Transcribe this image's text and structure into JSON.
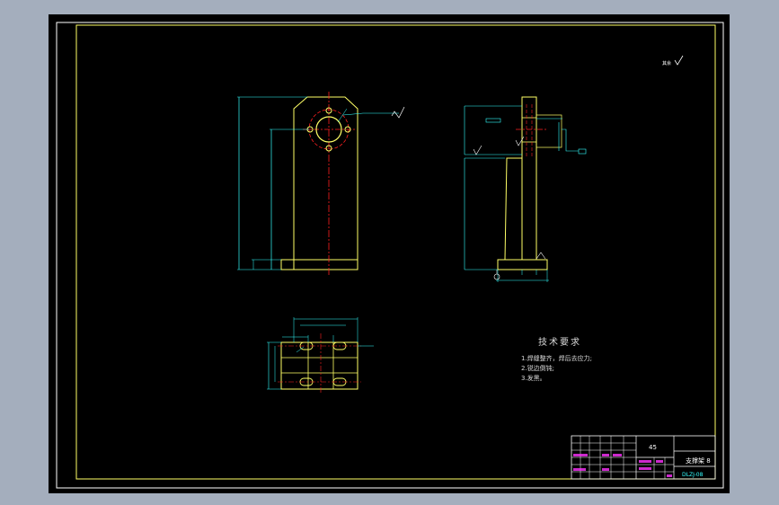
{
  "app": {
    "background": "#a4aebd",
    "canvas_background": "#000000"
  },
  "colors": {
    "border": "#ffffff",
    "frame": "#ffff66",
    "outline": "#ffff66",
    "dimension": "#33ffff",
    "center": "#ff2020",
    "magenta": "#ff33ff",
    "text": "#ffffff"
  },
  "drawing": {
    "roughness_note": "其余",
    "tech": {
      "title": "技术要求",
      "items": [
        "1.焊缝整齐，焊后去应力;",
        "2.锐边倒钝;",
        "3.发黑。"
      ]
    },
    "title_block": {
      "material": "45",
      "part_name": "支撑架 8",
      "drawing_no": "DLZJ-08"
    }
  }
}
